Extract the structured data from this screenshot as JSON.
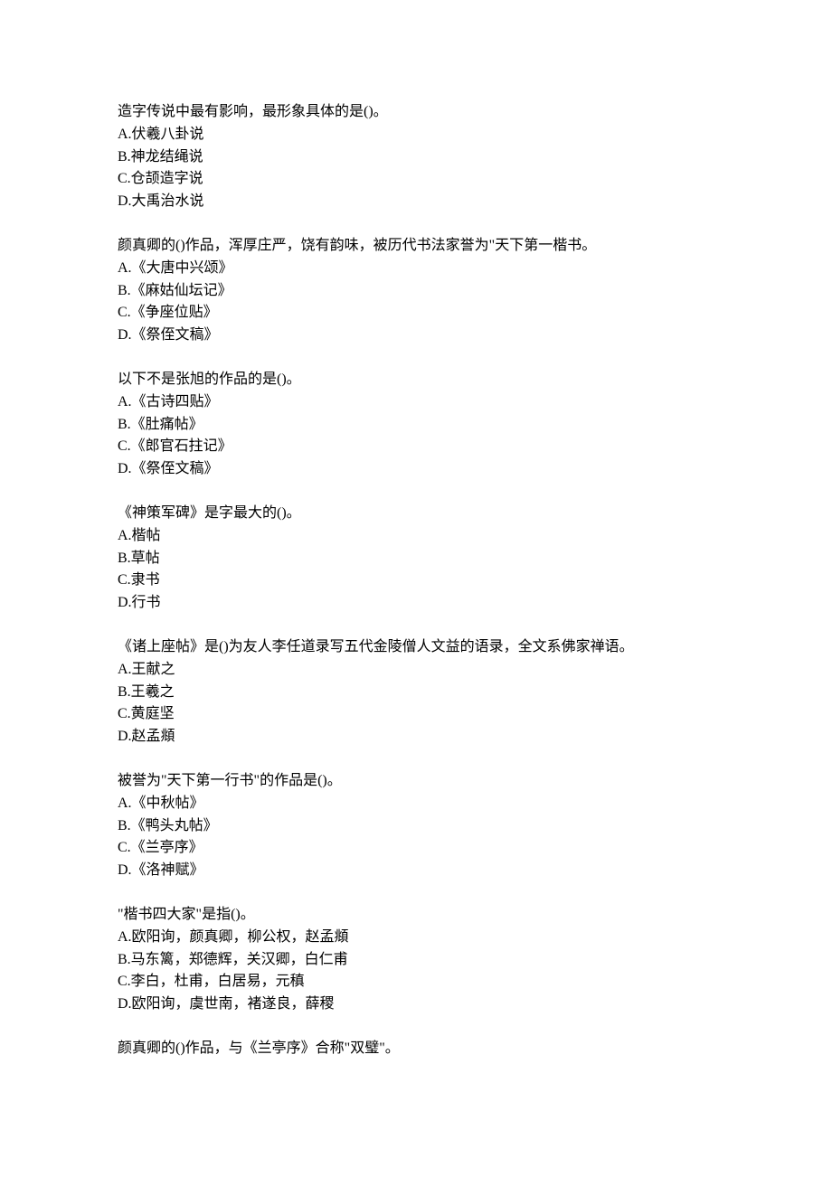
{
  "questions": [
    {
      "stem": "造字传说中最有影响，最形象具体的是()。",
      "options": [
        "A.伏羲八卦说",
        "B.神龙结绳说",
        "C.仓颉造字说",
        "D.大禹治水说"
      ]
    },
    {
      "stem": "颜真卿的()作品，浑厚庄严，饶有韵味，被历代书法家誉为\"天下第一楷书。",
      "options": [
        "A.《大唐中兴颂》",
        "B.《麻姑仙坛记》",
        "C.《争座位贴》",
        "D.《祭侄文稿》"
      ]
    },
    {
      "stem": "以下不是张旭的作品的是()。",
      "options": [
        "A.《古诗四贴》",
        "B.《肚痛帖》",
        "C.《郎官石拄记》",
        "D.《祭侄文稿》"
      ]
    },
    {
      "stem": "《神策军碑》是字最大的()。",
      "options": [
        "A.楷帖",
        "B.草帖",
        "C.隶书",
        "D.行书"
      ]
    },
    {
      "stem": "《诸上座帖》是()为友人李任道录写五代金陵僧人文益的语录，全文系佛家禅语。",
      "options": [
        "A.王献之",
        "B.王羲之",
        "C.黄庭坚",
        "D.赵孟頫"
      ]
    },
    {
      "stem": "被誉为\"天下第一行书\"的作品是()。",
      "options": [
        "A.《中秋帖》",
        "B.《鸭头丸帖》",
        "C.《兰亭序》",
        "D.《洛神赋》"
      ]
    },
    {
      "stem": "\"楷书四大家\"是指()。",
      "options": [
        "A.欧阳询，颜真卿，柳公权，赵孟頫",
        "B.马东篱，郑德辉，关汉卿，白仁甫",
        "C.李白，杜甫，白居易，元稹",
        "D.欧阳询，虞世南，褚遂良，薛稷"
      ]
    },
    {
      "stem": "颜真卿的()作品，与《兰亭序》合称\"双璧\"。",
      "options": []
    }
  ]
}
